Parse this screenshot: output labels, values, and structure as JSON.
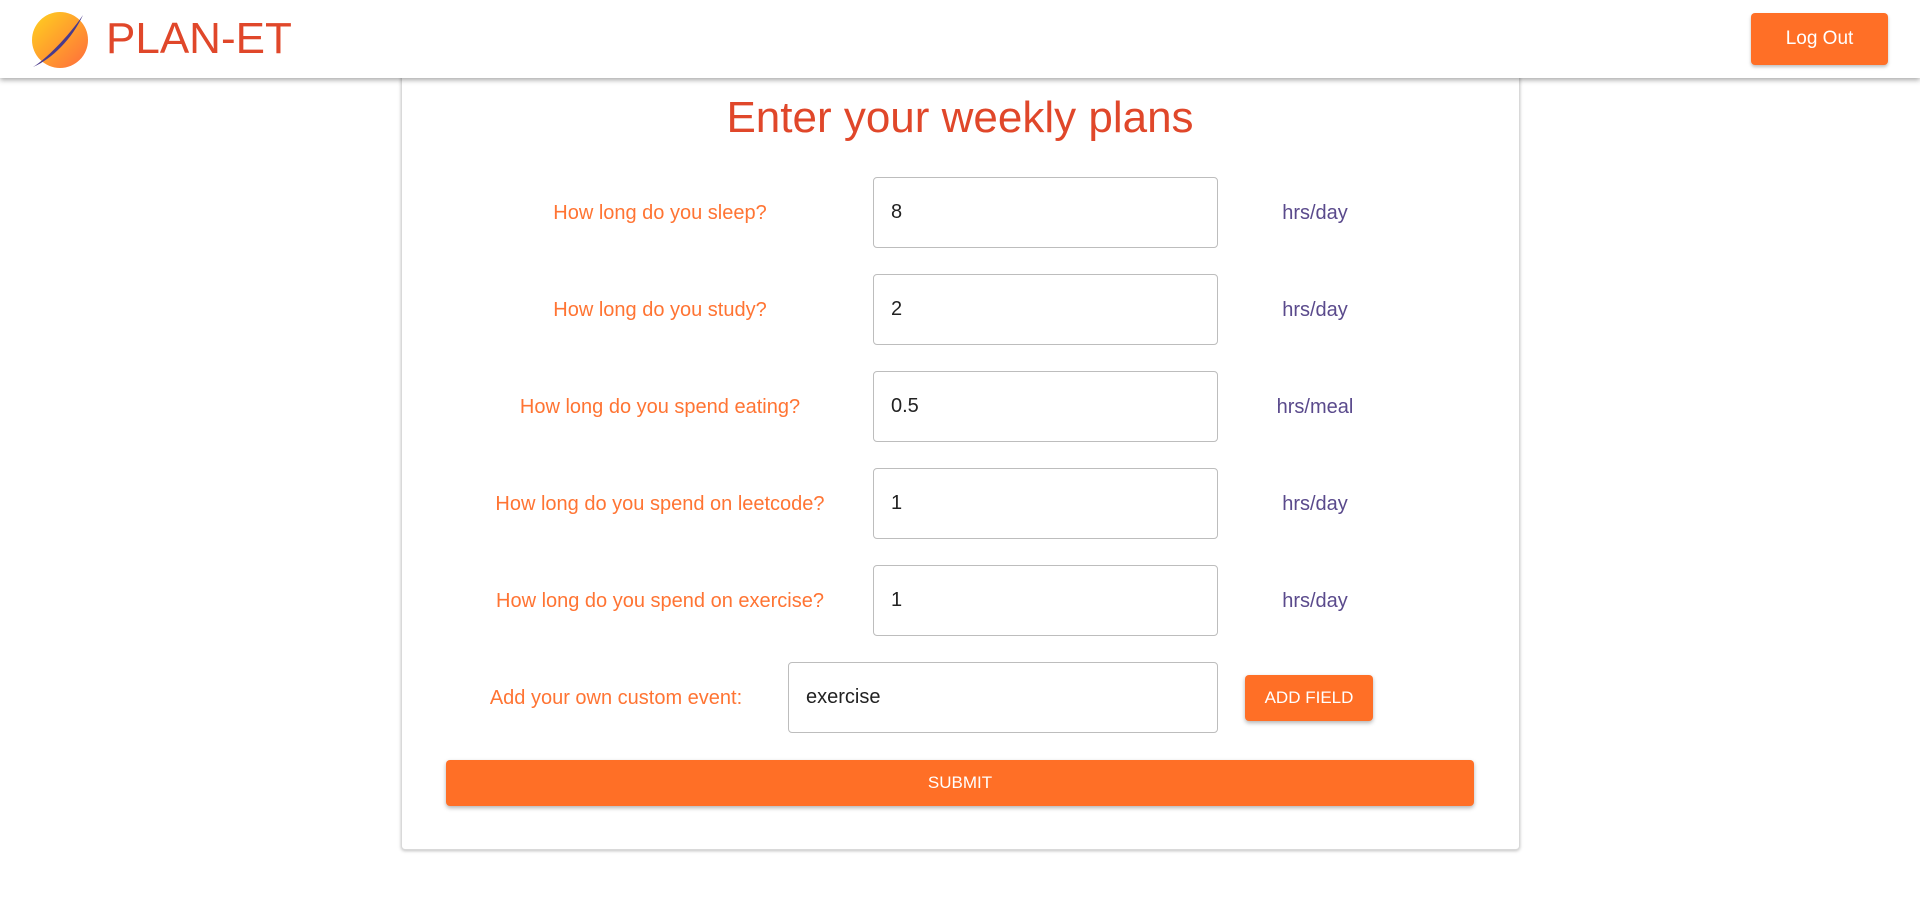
{
  "header": {
    "brand": "PLAN-ET",
    "logout_label": "Log Out",
    "logo_icon": "planet-icon"
  },
  "form": {
    "title": "Enter your weekly plans",
    "rows": [
      {
        "label": "How long do you sleep?",
        "value": "8",
        "unit": "hrs/day"
      },
      {
        "label": "How long do you study?",
        "value": "2",
        "unit": "hrs/day"
      },
      {
        "label": "How long do you spend eating?",
        "value": "0.5",
        "unit": "hrs/meal"
      },
      {
        "label": "How long do you spend on leetcode?",
        "value": "1",
        "unit": "hrs/day"
      },
      {
        "label": "How long do you spend on exercise?",
        "value": "1",
        "unit": "hrs/day"
      }
    ],
    "custom": {
      "label": "Add your own custom event:",
      "value": "exercise",
      "add_label": "ADD FIELD"
    },
    "submit_label": "SUBMIT"
  },
  "colors": {
    "accent": "#ff6f26",
    "title": "#e0472a",
    "label": "#ff7433",
    "unit": "#5a4a8c"
  }
}
